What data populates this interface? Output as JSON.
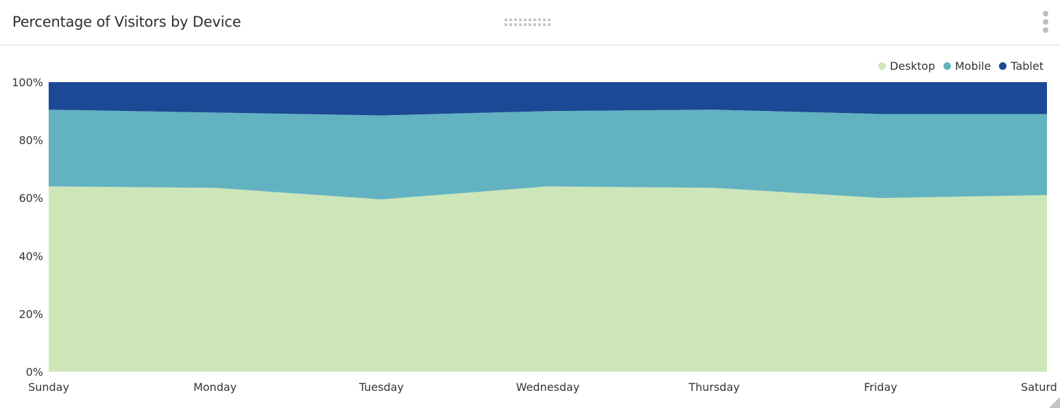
{
  "widget": {
    "title": "Percentage of Visitors by Device",
    "drag_handle_icon": "drag-handle-icon",
    "menu_icon": "vertical-ellipsis-icon",
    "resize_icon": "resize-corner-icon"
  },
  "legend": [
    {
      "label": "Desktop",
      "color": "#cde6b8"
    },
    {
      "label": "Mobile",
      "color": "#62b2c1"
    },
    {
      "label": "Tablet",
      "color": "#1c4995"
    }
  ],
  "chart_data": {
    "type": "area",
    "stacked": true,
    "normalized": true,
    "title": "Percentage of Visitors by Device",
    "xlabel": "",
    "ylabel": "",
    "categories": [
      "Sunday",
      "Monday",
      "Tuesday",
      "Wednesday",
      "Thursday",
      "Friday",
      "Saturd"
    ],
    "series": [
      {
        "name": "Desktop",
        "color": "#cde6b8",
        "values": [
          64,
          63.5,
          59.5,
          64,
          63.5,
          60,
          61
        ]
      },
      {
        "name": "Mobile",
        "color": "#62b2c1",
        "values": [
          26.5,
          26,
          29,
          26,
          27,
          29,
          28
        ]
      },
      {
        "name": "Tablet",
        "color": "#1c4995",
        "values": [
          9.5,
          10.5,
          11.5,
          10,
          9.5,
          11,
          11
        ]
      }
    ],
    "yticks": [
      "0%",
      "20%",
      "40%",
      "60%",
      "80%",
      "100%"
    ],
    "ylim": [
      0,
      100
    ],
    "grid": false,
    "legend_position": "top-right"
  }
}
